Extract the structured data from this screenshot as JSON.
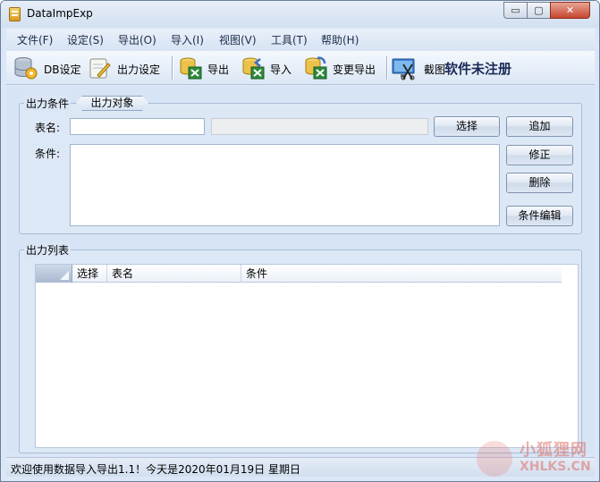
{
  "window": {
    "title": "DataImpExp",
    "min_glyph": "▭",
    "max_glyph": "▢",
    "close_glyph": "✕"
  },
  "menu": {
    "items": [
      "文件(F)",
      "设定(S)",
      "导出(O)",
      "导入(I)",
      "视图(V)",
      "工具(T)",
      "帮助(H)"
    ]
  },
  "toolbar": {
    "db_settings": "DB设定",
    "output_settings": "出力设定",
    "export": "导出",
    "import": "导入",
    "change_export": "变更导出",
    "screenshot": "截图",
    "registration": "软件未注册"
  },
  "conditions": {
    "group_label": "出力条件",
    "tab_label": "出力对象",
    "table_name_label": "表名:",
    "table_name_value": "",
    "condition_label": "条件:",
    "condition_value": "",
    "select_button": "选择",
    "add_button": "追加",
    "modify_button": "修正",
    "delete_button": "删除",
    "edit_button": "条件编辑"
  },
  "output_list": {
    "group_label": "出力列表",
    "columns": [
      "选择",
      "表名",
      "条件"
    ]
  },
  "status": {
    "text": "欢迎使用数据导入导出1.1！今天是2020年01月19日   星期日"
  },
  "watermark": {
    "top": "小狐狸网",
    "bottom": "XHLKS.CN"
  },
  "colors": {
    "accent": "#1b2a55",
    "window_bg": "#dbe7f6",
    "close_button": "#c74630"
  }
}
